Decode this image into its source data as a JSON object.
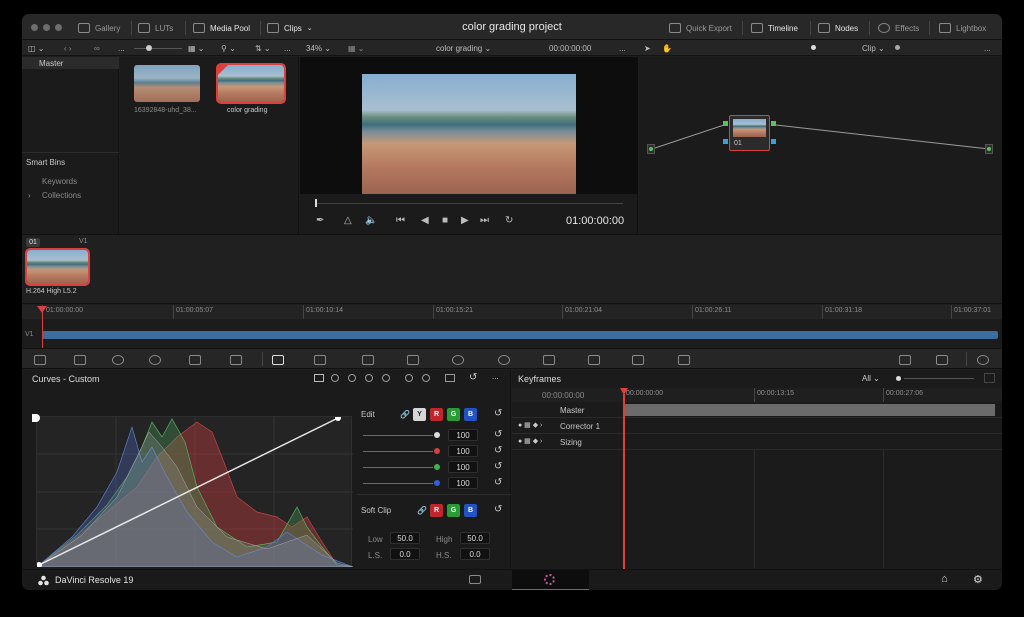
{
  "titlebar": {
    "project_title": "color grading project",
    "left_items": [
      "Gallery",
      "LUTs",
      "Media Pool",
      "Clips"
    ],
    "right_items": [
      "Quick Export",
      "Timeline",
      "Nodes",
      "Effects",
      "Lightbox"
    ]
  },
  "toolbar": {
    "zoom": "34%",
    "timeline_name": "color grading",
    "timecode": "00:00:00:00",
    "node_mode": "Clip"
  },
  "media_pool": {
    "master_label": "Master",
    "smart_bins_label": "Smart Bins",
    "smart_bins_items": [
      "Keywords",
      "Collections"
    ],
    "clips": [
      {
        "name": "16392848-uhd_38..."
      },
      {
        "name": "color grading"
      }
    ]
  },
  "viewer": {
    "playhead_timecode": "01:00:00:00"
  },
  "node_graph": {
    "node_label": "01"
  },
  "clips_strip": {
    "clip_number": "01",
    "track": "V1",
    "codec": "H.264 High L5.2"
  },
  "timeline": {
    "track_label": "V1",
    "ticks": [
      "01:00:00:00",
      "01:00:05:07",
      "01:00:10:14",
      "01:00:15:21",
      "01:00:21:04",
      "01:00:26:11",
      "01:00:31:18",
      "01:00:37:01"
    ]
  },
  "curves": {
    "title": "Curves - Custom",
    "edit_label": "Edit",
    "channels": [
      "Y",
      "R",
      "G",
      "B"
    ],
    "intensity_values": [
      "100",
      "100",
      "100",
      "100"
    ],
    "soft_clip_label": "Soft Clip",
    "low_label": "Low",
    "low_value": "50.0",
    "high_label": "High",
    "high_value": "50.0",
    "ls_label": "L.S.",
    "ls_value": "0.0",
    "hs_label": "H.S.",
    "hs_value": "0.0",
    "histogram_colors": {
      "red": "#b83b3b",
      "green": "#4a9a55",
      "blue": "#4a68b5",
      "luma": "#9a9a9a"
    }
  },
  "keyframes": {
    "title": "Keyframes",
    "filter": "All",
    "timecode": "00:00:00:00",
    "ticks": [
      "00:00:00:00",
      "00:00:13:15",
      "00:00:27:06"
    ],
    "rows": [
      "Master",
      "Corrector 1",
      "Sizing"
    ]
  },
  "footer": {
    "app_name": "DaVinci Resolve 19"
  },
  "colors": {
    "accent_red": "#d9403f",
    "clip_blue": "#3b6e9f"
  }
}
